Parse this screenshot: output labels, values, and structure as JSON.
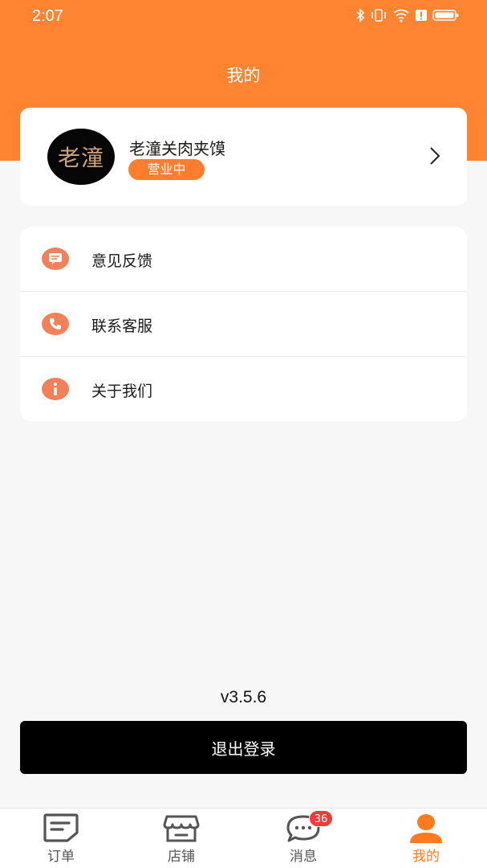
{
  "status_bar": {
    "time": "2:07",
    "icons": [
      "bluetooth-icon",
      "vibrate-icon",
      "wifi-icon",
      "alert-icon",
      "battery-icon"
    ]
  },
  "header": {
    "title": "我的"
  },
  "store": {
    "avatar_text": "老潼",
    "name": "老潼关肉夹馍",
    "status": "营业中"
  },
  "menu": [
    {
      "label": "意见反馈",
      "icon": "feedback-icon"
    },
    {
      "label": "联系客服",
      "icon": "phone-icon"
    },
    {
      "label": "关于我们",
      "icon": "info-icon"
    }
  ],
  "version": "v3.5.6",
  "logout_label": "退出登录",
  "tabs": [
    {
      "label": "订单",
      "icon": "orders-icon",
      "active": false
    },
    {
      "label": "店铺",
      "icon": "store-icon",
      "active": false
    },
    {
      "label": "消息",
      "icon": "message-icon",
      "active": false,
      "badge": "36"
    },
    {
      "label": "我的",
      "icon": "user-icon",
      "active": true
    }
  ],
  "colors": {
    "accent": "#ff8431",
    "badge_red": "#f43b3b",
    "menu_icon": "#f2815a",
    "logout_bg": "#000000"
  }
}
